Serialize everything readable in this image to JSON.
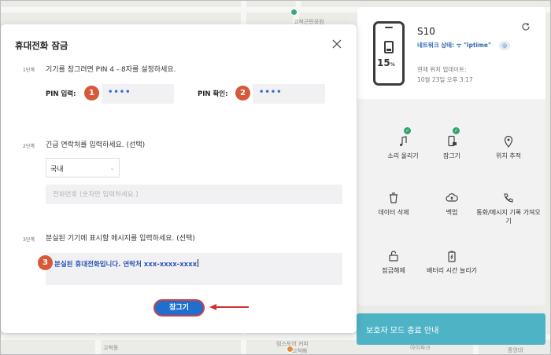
{
  "map": {
    "labels": [
      "고척근린공원",
      "아이파크",
      "고척동",
      "멈스토어 커피",
      "고척빠",
      "중앙대"
    ]
  },
  "dialog": {
    "title": "휴대전화 잠금",
    "steps": [
      {
        "tag": "1단계",
        "text": "기기를 잠그려면 PIN 4 - 8자를 설정하세요."
      },
      {
        "tag": "2단계",
        "text": "긴급 연락처를 입력하세요. (선택)"
      },
      {
        "tag": "3단계",
        "text": "분실된 기기에 표시할 메시지를 입력하세요. (선택)"
      }
    ],
    "pin_input_label": "PIN 입력:",
    "pin_input_value": "••••",
    "pin_confirm_label": "PIN 확인:",
    "pin_confirm_value": "••••",
    "country_select": "국내",
    "phone_placeholder": "전화번호 (숫자만 입력하세요.)",
    "message_value": "분실된 휴대전화입니다. 연락처 xxx-xxxx-xxxx",
    "lock_button": "잠그기",
    "callouts": [
      "1",
      "2",
      "3"
    ]
  },
  "device": {
    "name": "S10",
    "battery": "15",
    "battery_unit": "%",
    "network_status": "네트워크 상태: ",
    "network_name": "iptime",
    "location_label": "현재 위치 업데이트:",
    "location_time": "10월 23일 오후 3:17"
  },
  "actions": [
    {
      "label": "소리 울리기",
      "icon": "music-note-icon",
      "checked": true
    },
    {
      "label": "잠그기",
      "icon": "phone-lock-icon",
      "checked": true
    },
    {
      "label": "위치 추적",
      "icon": "location-pin-icon",
      "checked": false
    },
    {
      "label": "데이터 삭제",
      "icon": "trash-icon",
      "checked": false
    },
    {
      "label": "백업",
      "icon": "cloud-upload-icon",
      "checked": false
    },
    {
      "label": "통화/메시지 기록 가져오기",
      "icon": "call-log-icon",
      "checked": false
    },
    {
      "label": "잠금해제",
      "icon": "unlock-icon",
      "checked": false
    },
    {
      "label": "배터리 시간 늘리기",
      "icon": "battery-extend-icon",
      "checked": false
    }
  ],
  "guardian_bar": "보호자 모드 종료 안내",
  "colors": {
    "accent": "#1f6fd1",
    "callout": "#d65a3a",
    "check": "#34a36b",
    "guardian": "#4fb3c6",
    "pin_text": "#3a6bd2"
  }
}
